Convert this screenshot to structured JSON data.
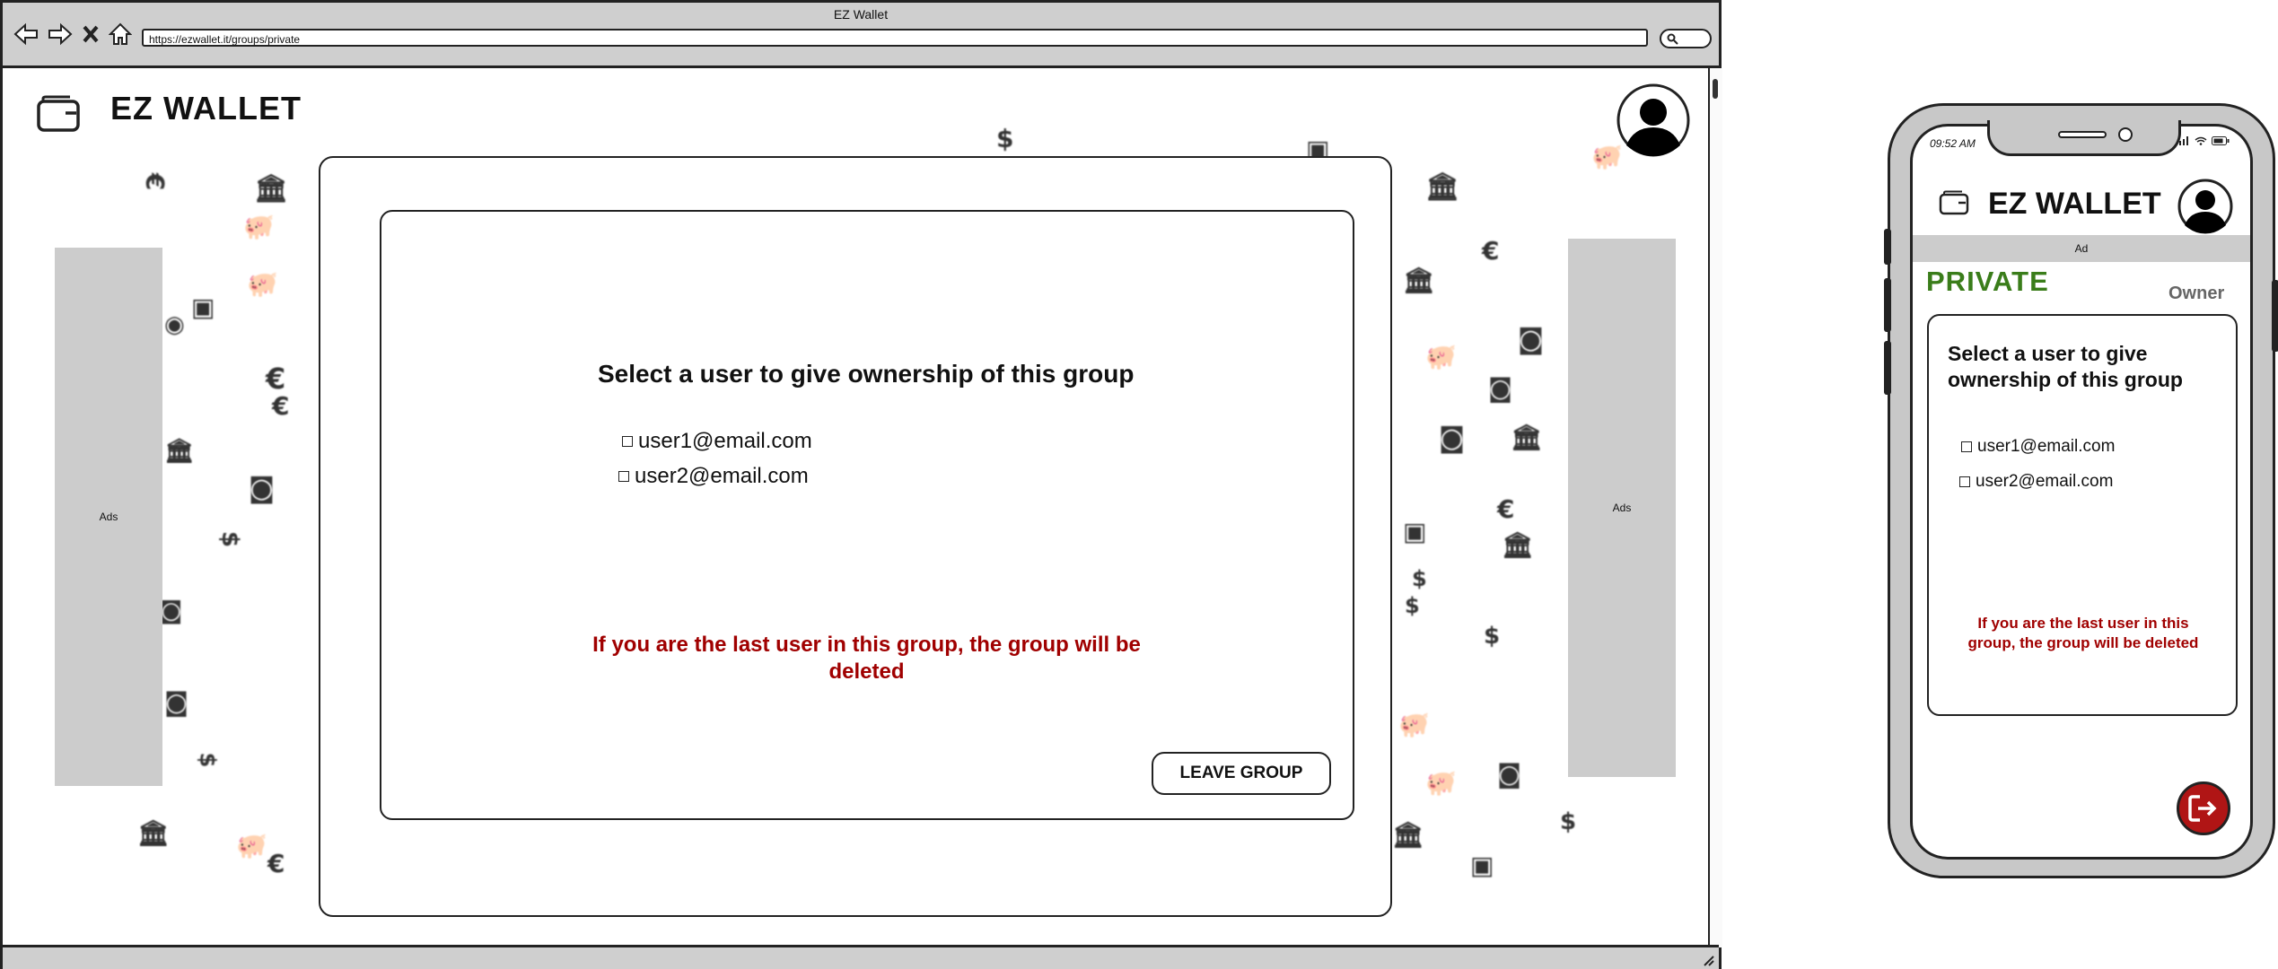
{
  "browser": {
    "window_title": "EZ Wallet",
    "url": "https://ezwallet.it/groups/private"
  },
  "app": {
    "title": "EZ WALLET",
    "logo_icon": "wallet-icon",
    "avatar_icon": "user-avatar-icon"
  },
  "desktop": {
    "ads_left": "Ads",
    "ads_right": "Ads",
    "prompt": "Select a user to give ownership of this group",
    "users": [
      "user1@email.com",
      "user2@email.com"
    ],
    "warning": "If you are the last user in this group, the group will be deleted",
    "leave_button": "LEAVE GROUP"
  },
  "phone": {
    "time": "09:52 AM",
    "title": "EZ WALLET",
    "ad_label": "Ad",
    "group_name": "PRIVATE",
    "role": "Owner",
    "prompt": "Select a user to give ownership of this group",
    "users": [
      "user1@email.com",
      "user2@email.com"
    ],
    "warning": "If you are the last user in this group, the group will be deleted",
    "exit_icon": "exit-icon"
  },
  "colors": {
    "ad_gray": "#cccccc",
    "warning_red": "#a00000",
    "group_green": "#3a7d1a",
    "exit_button_red": "#b01515",
    "chrome_gray": "#cfcfcf"
  }
}
